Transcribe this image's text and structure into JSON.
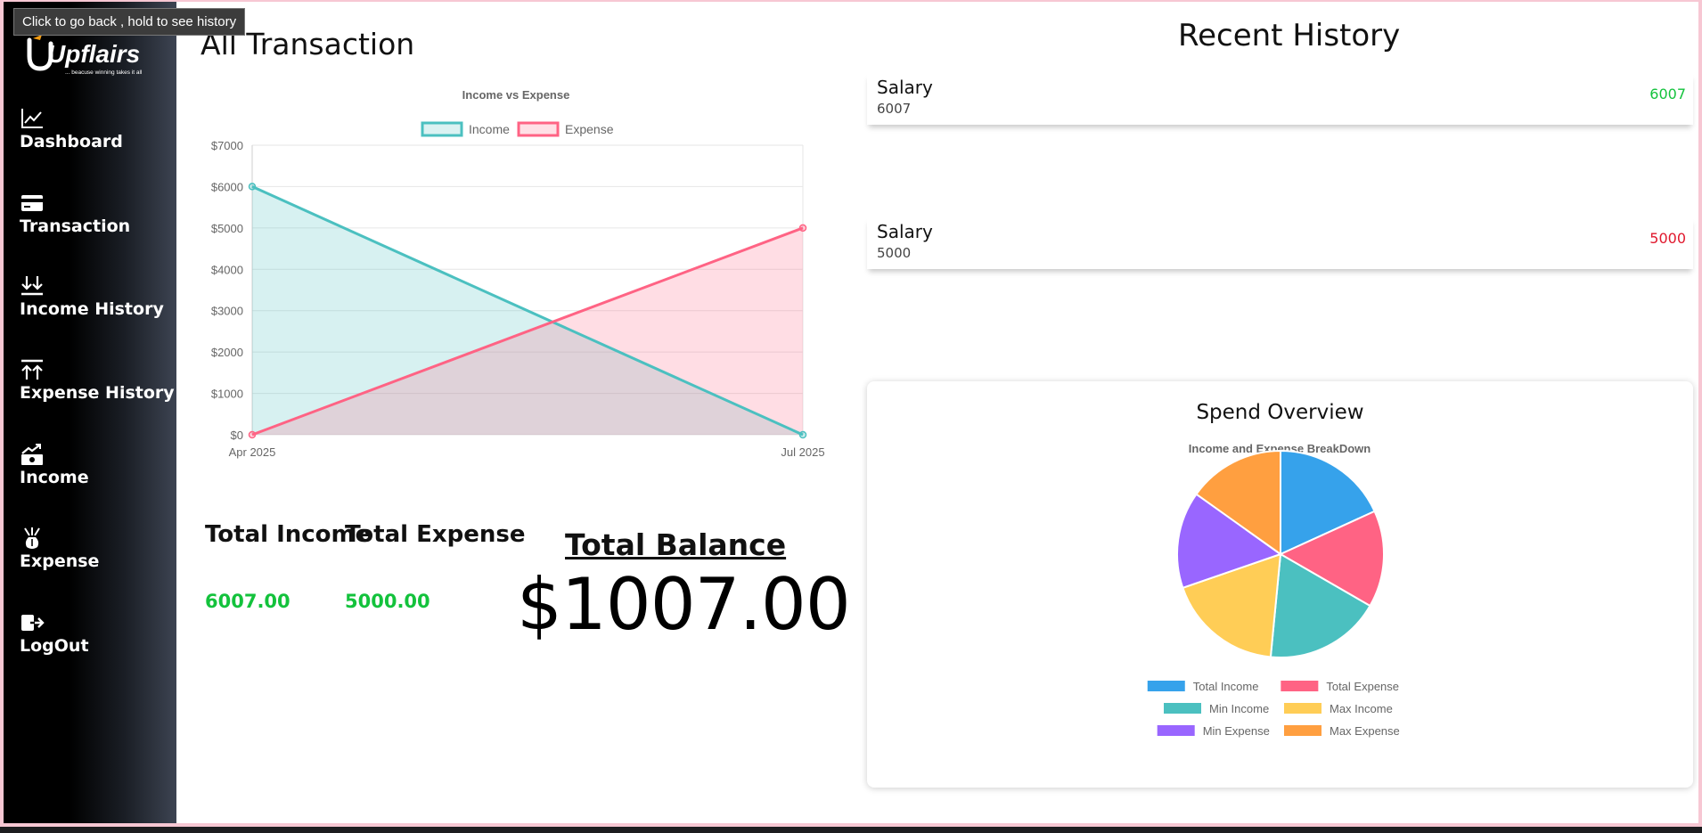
{
  "tooltip": "Click to go back , hold to see history",
  "logo": {
    "brand": "Upflairs",
    "tagline": "... beacuse winning takes it all"
  },
  "sidebar": {
    "items": [
      {
        "label": "Dashboard",
        "icon": "chart-line-icon"
      },
      {
        "label": "Transaction",
        "icon": "credit-card-icon"
      },
      {
        "label": "Income History",
        "icon": "arrows-down-icon"
      },
      {
        "label": "Expense History",
        "icon": "arrows-up-icon"
      },
      {
        "label": "Income",
        "icon": "money-trend-icon"
      },
      {
        "label": "Expense",
        "icon": "money-bag-icon"
      },
      {
        "label": "LogOut",
        "icon": "logout-icon"
      }
    ]
  },
  "main": {
    "title": "All Transaction",
    "totals": {
      "income_label": "Total Income",
      "income_value": "6007.00",
      "expense_label": "Total Expense",
      "expense_value": "5000.00",
      "balance_label": "Total Balance",
      "balance_value": "$1007.00"
    }
  },
  "history": {
    "title": "Recent History",
    "items": [
      {
        "title": "Salary",
        "subtitle": "6007",
        "amount": "6007",
        "color": "#13c23c"
      },
      {
        "title": "Salary",
        "subtitle": "5000",
        "amount": "5000",
        "color": "#e0182d"
      }
    ]
  },
  "spend": {
    "title": "Spend Overview"
  },
  "chart_data": [
    {
      "type": "area",
      "title": "Income vs Expense",
      "x": [
        "Apr 2025",
        "Jul 2025"
      ],
      "series": [
        {
          "name": "Income",
          "values": [
            6000,
            0
          ],
          "color": "#4bc0c0"
        },
        {
          "name": "Expense",
          "values": [
            0,
            5000
          ],
          "color": "#ff6384"
        }
      ],
      "ylim": [
        0,
        7000
      ],
      "yticks": [
        "$0",
        "$1000",
        "$2000",
        "$3000",
        "$4000",
        "$5000",
        "$6000",
        "$7000"
      ],
      "grid": true,
      "legend": "top"
    },
    {
      "type": "pie",
      "title": "Income and Expense BreakDown",
      "categories": [
        "Total Income",
        "Total Expense",
        "Min Income",
        "Max Income",
        "Min Expense",
        "Max Expense"
      ],
      "values": [
        6007,
        5000,
        6007,
        6007,
        5000,
        5000
      ],
      "colors": [
        "#36a2eb",
        "#ff6384",
        "#4bc0c0",
        "#ffcd56",
        "#9966ff",
        "#ff9f40"
      ],
      "legend": "bottom"
    }
  ]
}
